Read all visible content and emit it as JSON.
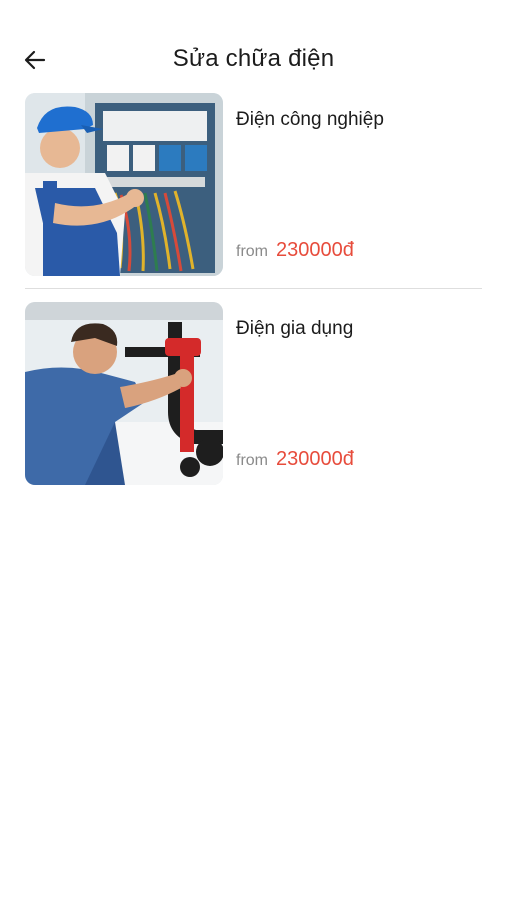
{
  "header": {
    "back_icon": "arrow-left-icon",
    "title": "Sửa chữa điện"
  },
  "services": [
    {
      "title": "Điện công nghiệp",
      "from_label": "from",
      "price": "230000đ",
      "image": "electrician-panel-photo"
    },
    {
      "title": "Điện gia dụng",
      "from_label": "from",
      "price": "230000đ",
      "image": "plumber-wrench-photo"
    }
  ],
  "colors": {
    "price": "#e74c3c",
    "text": "#1c1c1c",
    "muted": "#8a8a8a",
    "divider": "#dedede"
  }
}
